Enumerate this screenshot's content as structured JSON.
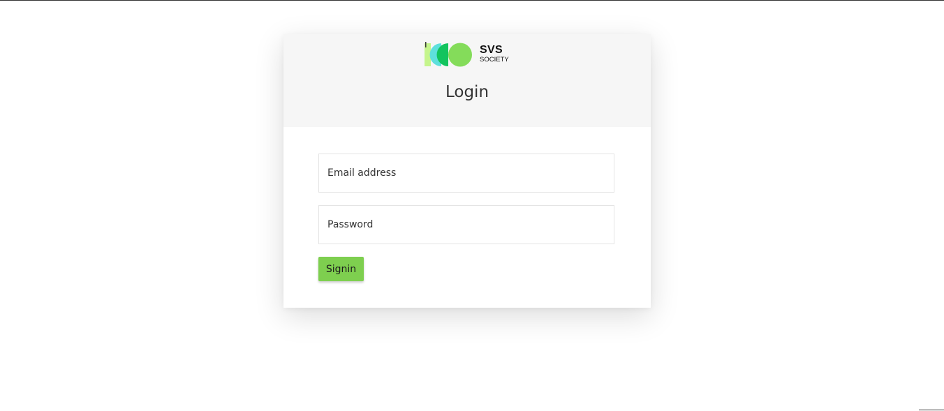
{
  "brand": {
    "name": "SVS",
    "tagline": "SOCIETY",
    "colors": {
      "lime": "#c5f58c",
      "cyan": "#5ee0dc",
      "green": "#12c45e",
      "light_green": "#84dc5a"
    }
  },
  "login": {
    "title": "Login",
    "email": {
      "placeholder": "Email address",
      "value": ""
    },
    "password": {
      "placeholder": "Password",
      "value": ""
    },
    "submit_label": "Signin",
    "accent_color": "#7ecf4f"
  }
}
